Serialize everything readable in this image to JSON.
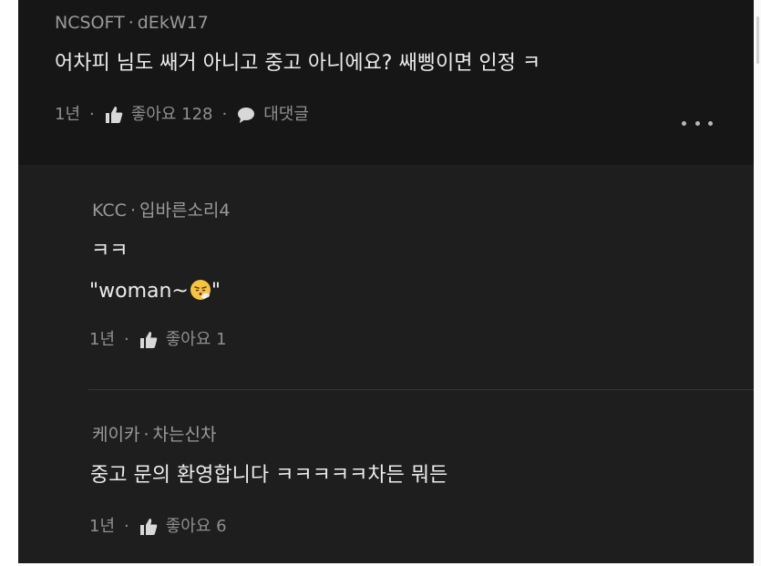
{
  "comments": [
    {
      "author_org": "NCSOFT",
      "separator": "·",
      "author_name": "dEkW17",
      "text": "어차피 님도 쌔거 아니고 중고 아니에요? 쌔삥이면 인정 ㅋ",
      "time": "1년",
      "like_label": "좋아요 128",
      "reply_label": "대댓글"
    },
    {
      "author_org": "KCC",
      "separator": "·",
      "author_name": "입바른소리4",
      "text_line1": "ㅋㅋ",
      "text_line2_before": "\"woman~",
      "text_line2_after": "\"",
      "emoji_name": "face-with-steam-emoji",
      "time": "1년",
      "like_label": "좋아요 1"
    },
    {
      "author_org": "케이카",
      "separator": "·",
      "author_name": "차는신차",
      "text": "중고 문의 환영합니다 ㅋㅋㅋㅋㅋ차든 뭐든",
      "time": "1년",
      "like_label": "좋아요 6"
    }
  ],
  "icons": {
    "like": "thumbs-up-icon",
    "reply": "speech-bubble-icon",
    "more": "more-dots-icon"
  },
  "colors": {
    "top_background": "#161616",
    "reply_background": "#1e1e1e",
    "text": "#ececec",
    "meta": "#9a9a9a"
  }
}
